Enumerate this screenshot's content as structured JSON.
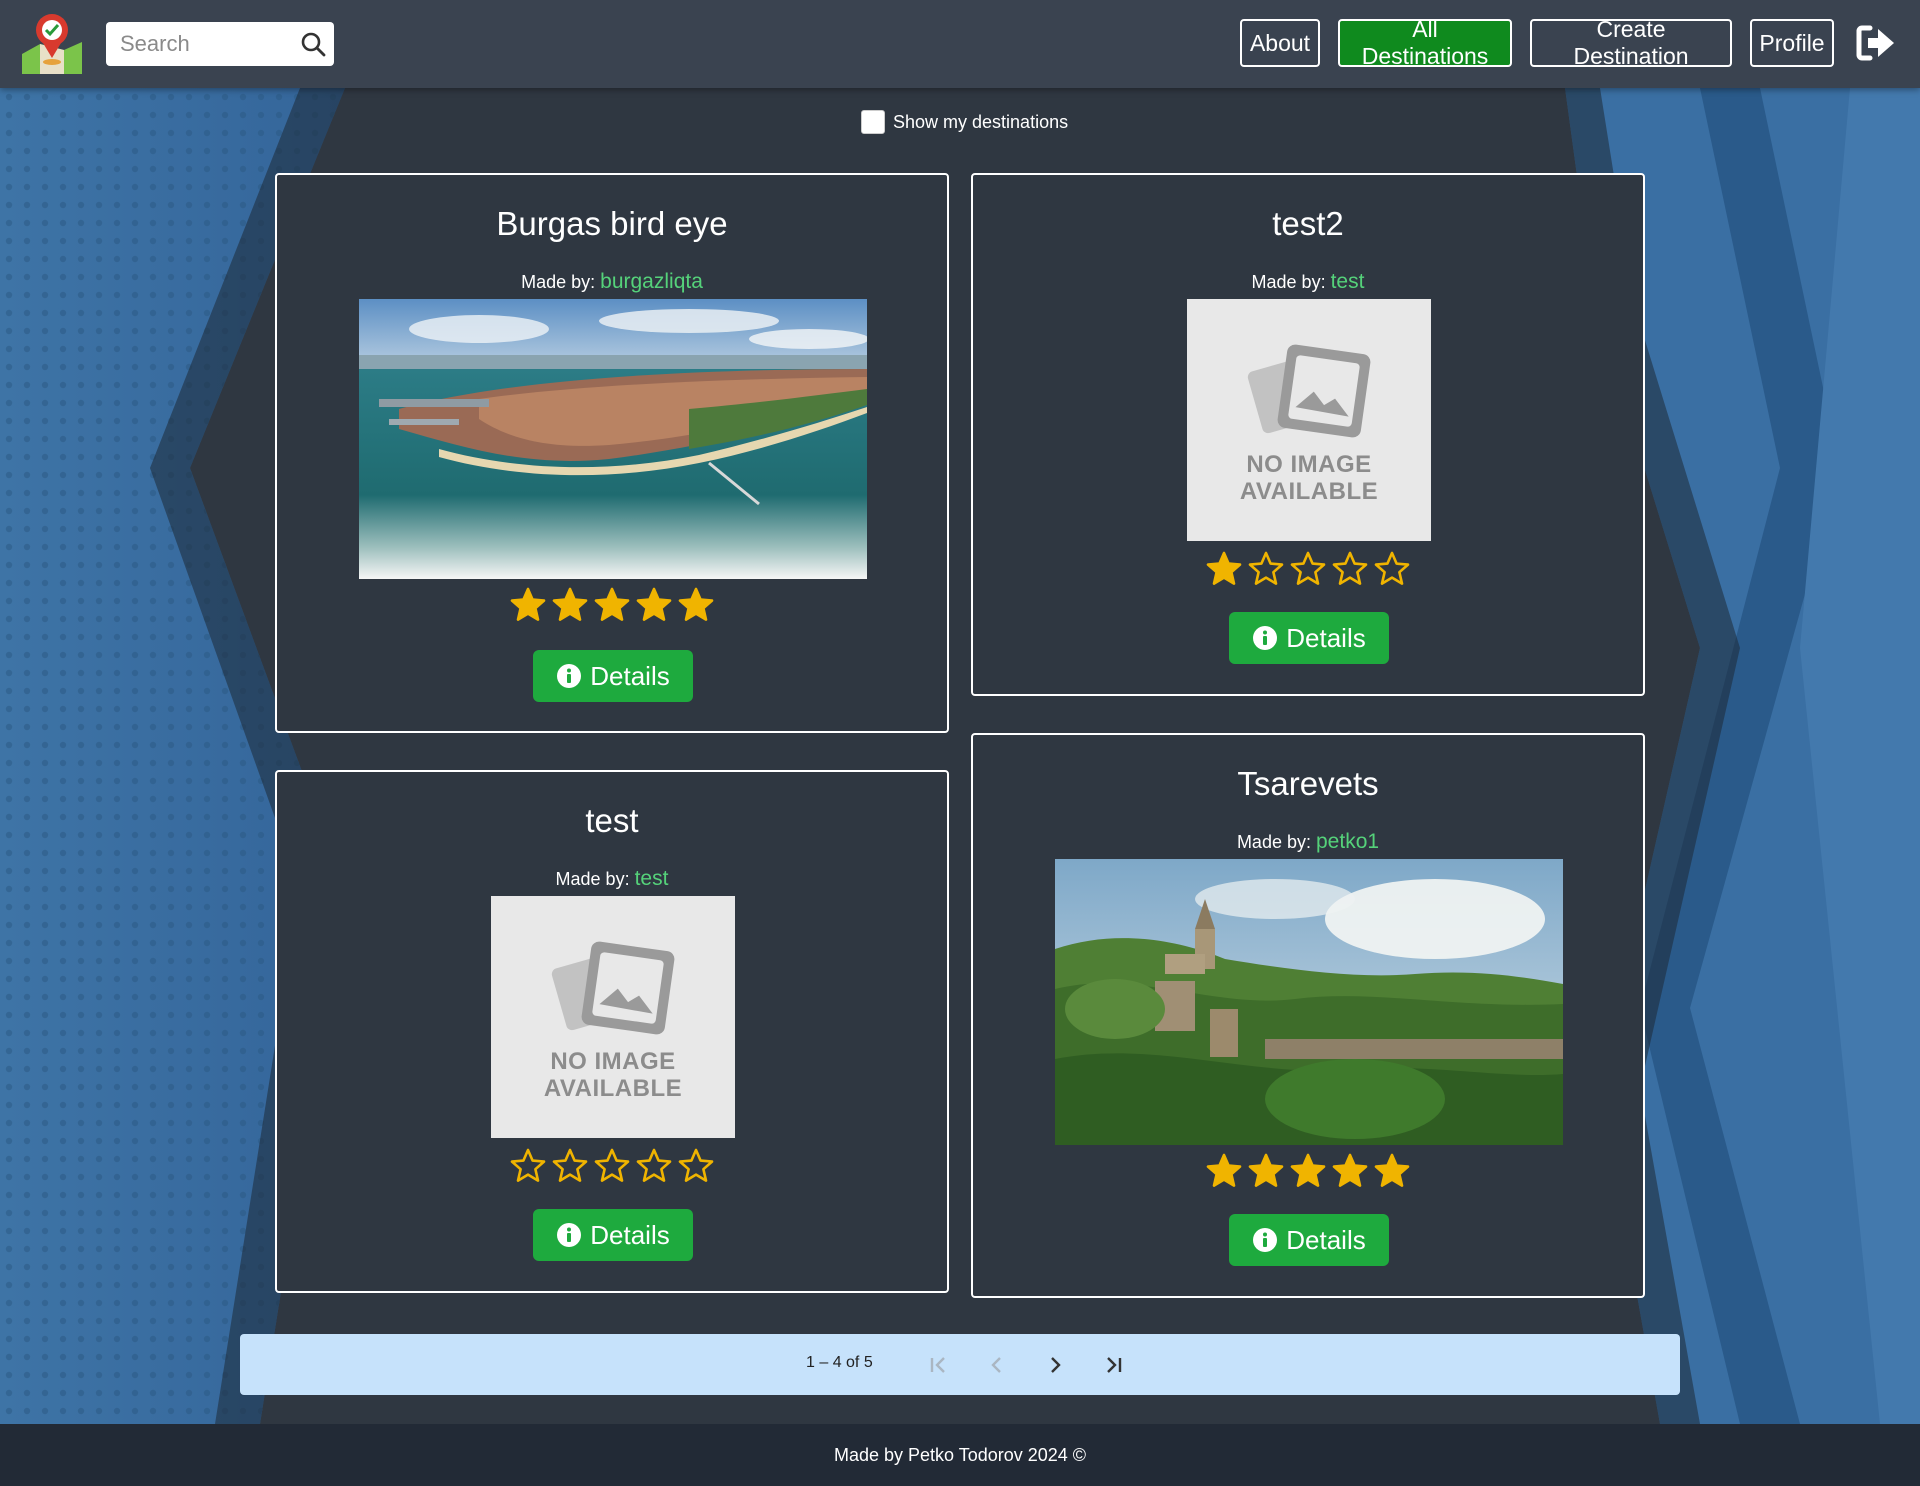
{
  "header": {
    "search_placeholder": "Search",
    "nav": {
      "about": "About",
      "all_destinations": "All Destinations",
      "create_destination": "Create Destination",
      "profile": "Profile"
    }
  },
  "filter": {
    "label": "Show my destinations",
    "checked": false
  },
  "cards": [
    {
      "title": "Burgas bird eye",
      "made_by_label": "Made by:",
      "author": "burgazliqta",
      "image": "aerial-city-photo",
      "rating": 5,
      "details_label": "Details"
    },
    {
      "title": "test2",
      "made_by_label": "Made by:",
      "author": "test",
      "image": "no-image-placeholder",
      "no_image_text": [
        "NO IMAGE",
        "AVAILABLE"
      ],
      "rating": 1,
      "details_label": "Details"
    },
    {
      "title": "test",
      "made_by_label": "Made by:",
      "author": "test",
      "image": "no-image-placeholder",
      "no_image_text": [
        "NO IMAGE",
        "AVAILABLE"
      ],
      "rating": 0,
      "details_label": "Details"
    },
    {
      "title": "Tsarevets",
      "made_by_label": "Made by:",
      "author": "petko1",
      "image": "fortress-hill-photo",
      "rating": 5,
      "details_label": "Details"
    }
  ],
  "paginator": {
    "range_label": "1 – 4 of 5"
  },
  "footer": {
    "text": "Made by Petko Todorov 2024 ©"
  },
  "colors": {
    "header_bg": "#3a4350",
    "active_nav": "#0f8a1e",
    "details_button": "#1eaa3e",
    "author_link": "#55d27a",
    "star": "#f0b400",
    "paginator_bg": "#c6e2fb",
    "footer_bg": "#222a36"
  }
}
